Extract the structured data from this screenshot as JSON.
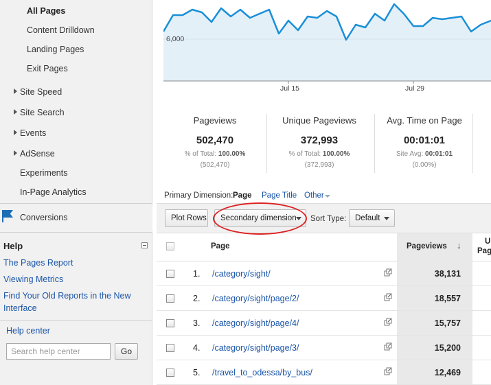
{
  "sidebar": {
    "sub_items": [
      {
        "label": "All Pages",
        "active": true
      },
      {
        "label": "Content Drilldown"
      },
      {
        "label": "Landing Pages"
      },
      {
        "label": "Exit Pages"
      }
    ],
    "sections": [
      {
        "label": "Site Speed",
        "expandable": true
      },
      {
        "label": "Site Search",
        "expandable": true
      },
      {
        "label": "Events",
        "expandable": true
      },
      {
        "label": "AdSense",
        "expandable": true
      },
      {
        "label": "Experiments",
        "expandable": false
      },
      {
        "label": "In-Page Analytics",
        "expandable": false
      }
    ],
    "conversions_label": "Conversions",
    "help": {
      "title": "Help",
      "links": [
        "The Pages Report",
        "Viewing Metrics",
        "Find Your Old Reports in the New Interface"
      ],
      "help_center": "Help center",
      "search_placeholder": "Search help center",
      "go_label": "Go"
    }
  },
  "chart": {
    "y_tick": "6,000",
    "x_ticks": [
      "Jul 15",
      "Jul 29"
    ],
    "line_color": "#1a8fd8",
    "fill_color": "#e4f0f8"
  },
  "summary": [
    {
      "label": "Pageviews",
      "value": "502,470",
      "sub1_prefix": "% of Total: ",
      "sub1_value": "100.00%",
      "sub2": "(502,470)"
    },
    {
      "label": "Unique Pageviews",
      "value": "372,993",
      "sub1_prefix": "% of Total: ",
      "sub1_value": "100.00%",
      "sub2": "(372,993)"
    },
    {
      "label": "Avg. Time on Page",
      "value": "00:01:01",
      "sub1_prefix": "Site Avg: ",
      "sub1_value": "00:01:01",
      "sub2": "(0.00%)"
    }
  ],
  "dimension": {
    "label": "Primary Dimension:",
    "selected": "Page",
    "options": [
      "Page Title",
      "Other"
    ]
  },
  "toolbar": {
    "plot_rows": "Plot Rows",
    "secondary_dimension": "Secondary dimension",
    "sort_type_label": "Sort Type:",
    "sort_type_value": "Default"
  },
  "table": {
    "col_page": "Page",
    "col_pageviews": "Pageviews",
    "col_next_top": "U",
    "col_next_bottom": "Pag",
    "rows": [
      {
        "num": "1.",
        "page": "/category/sight/",
        "pageviews": "38,131"
      },
      {
        "num": "2.",
        "page": "/category/sight/page/2/",
        "pageviews": "18,557"
      },
      {
        "num": "3.",
        "page": "/category/sight/page/4/",
        "pageviews": "15,757"
      },
      {
        "num": "4.",
        "page": "/category/sight/page/3/",
        "pageviews": "15,200"
      },
      {
        "num": "5.",
        "page": "/travel_to_odessa/by_bus/",
        "pageviews": "12,469"
      }
    ]
  }
}
